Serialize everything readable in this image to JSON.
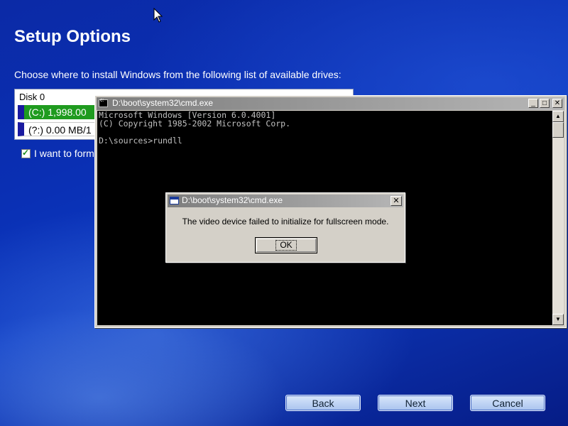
{
  "setup": {
    "title": "Setup Options",
    "instruction": "Choose where to install Windows from the following list of available drives:",
    "drive_list": {
      "header": "Disk 0",
      "items": [
        {
          "label": "(C:) 1,998.00",
          "selected": true
        },
        {
          "label": "(?:) 0.00 MB/1",
          "selected": false
        }
      ]
    },
    "format_checkbox": {
      "label": "I want to form",
      "checked": true
    },
    "buttons": {
      "back": "Back",
      "next": "Next",
      "cancel": "Cancel"
    }
  },
  "cmd_window": {
    "title": "D:\\boot\\system32\\cmd.exe",
    "lines": [
      "Microsoft Windows [Version 6.0.4001]",
      "(C) Copyright 1985-2002 Microsoft Corp.",
      "",
      "D:\\sources>rundll"
    ]
  },
  "error_dialog": {
    "title": "D:\\boot\\system32\\cmd.exe",
    "message": "The video device failed to initialize for fullscreen mode.",
    "ok_label": "OK"
  },
  "icons": {
    "cursor": "arrow-cursor-icon",
    "cmd_app": "cmd-app-icon",
    "dialog_app": "dialog-window-icon",
    "minimize": "minimize-icon",
    "maximize": "maximize-icon",
    "close": "close-icon",
    "checkbox": "checkmark-icon"
  },
  "colors": {
    "background": "#0a2fb3",
    "selected_row": "#1f9b1f",
    "console_bg": "#000000",
    "console_fg": "#c0c0c0",
    "window_chrome": "#d4d0c8"
  }
}
